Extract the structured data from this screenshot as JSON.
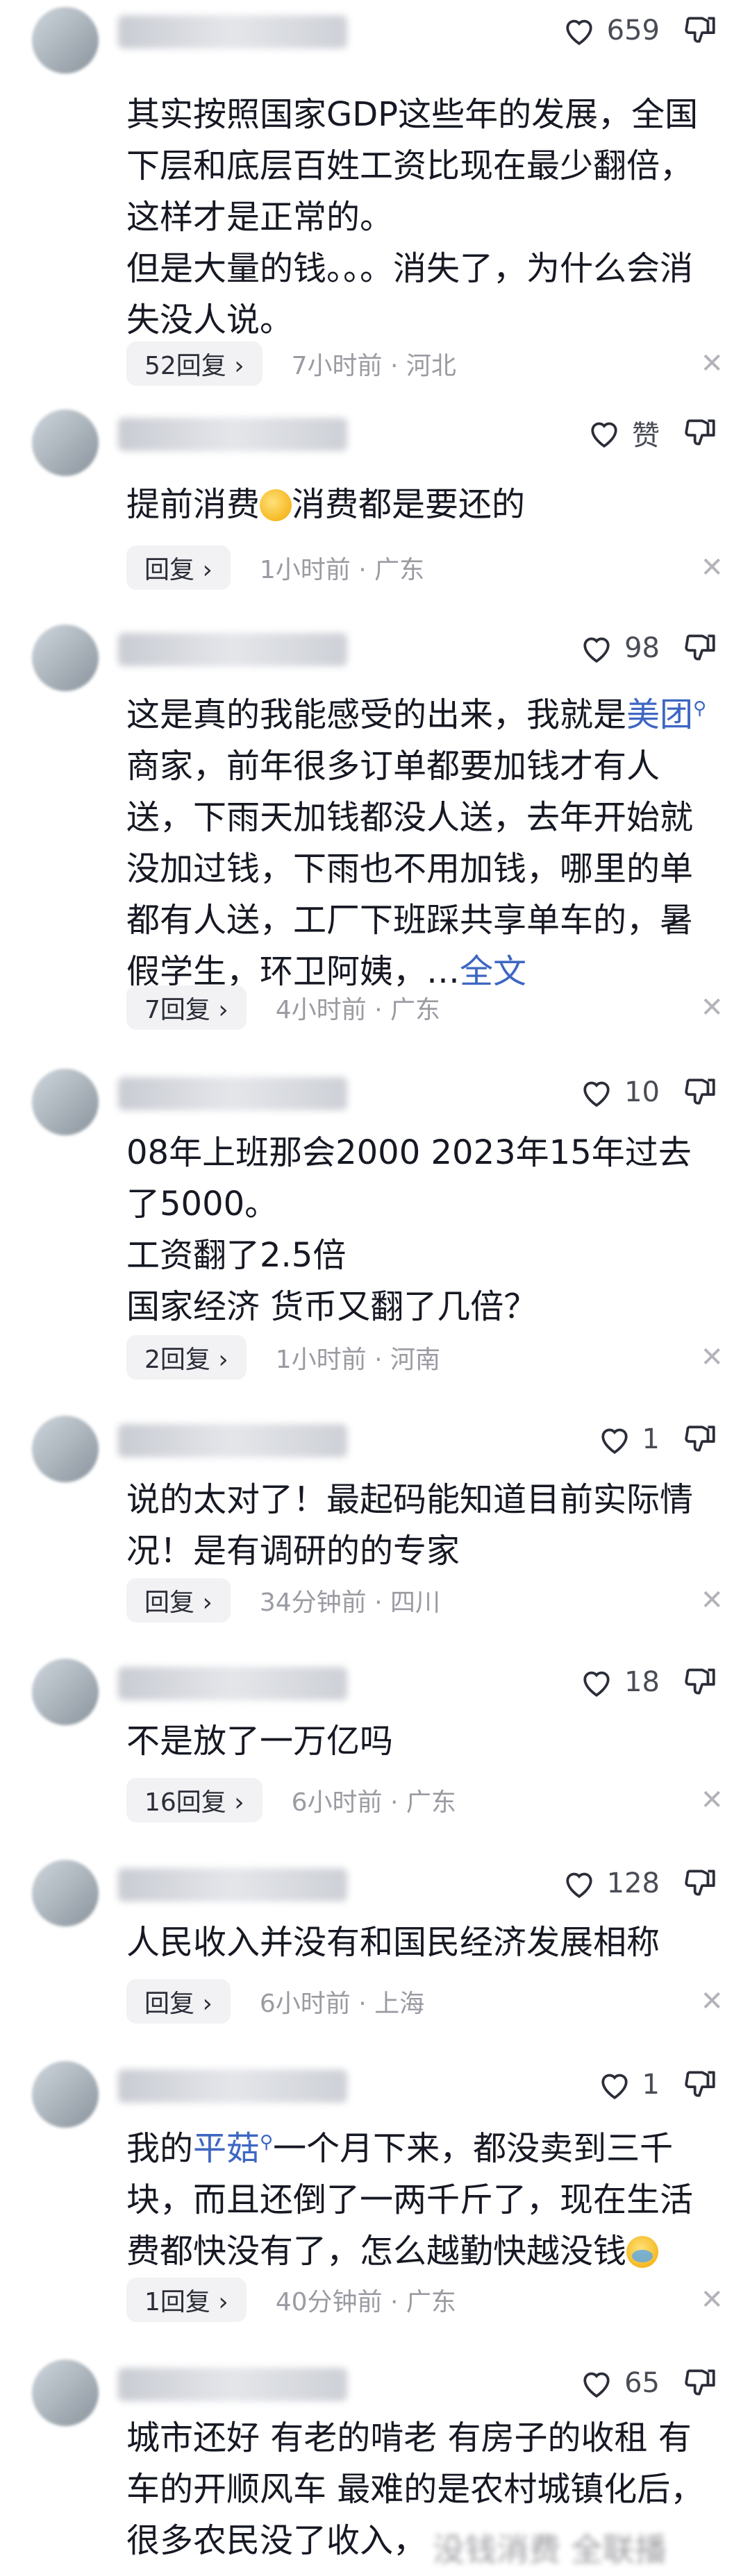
{
  "comments": [
    {
      "likes": "659",
      "text": "其实按照国家GDP这些年的发展，全国下层和底层百姓工资比现在最少翻倍，这样才是正常的。\n但是大量的钱。。。消失了，为什么会消失没人说。",
      "reply_label": "52回复 ›",
      "meta": "7小时前 · 河北"
    },
    {
      "likes": "赞",
      "text_pre": "提前消费",
      "text_post": "消费都是要还的",
      "reply_label": "回复 ›",
      "meta": "1小时前 · 广东"
    },
    {
      "likes": "98",
      "text_pre": "这是真的我能感受的出来，我就是",
      "link": "美团",
      "text_post": "商家，前年很多订单都要加钱才有人送，下雨天加钱都没人送，去年开始就没加过钱，下雨也不用加钱，哪里的单都有人送，工厂下班踩共享单车的，暑假学生，环卫阿姨，…",
      "more_label": "全文",
      "reply_label": "7回复 ›",
      "meta": "4小时前 · 广东"
    },
    {
      "likes": "10",
      "text": "08年上班那会2000 2023年15年过去了5000。\n工资翻了2.5倍\n国家经济 货币又翻了几倍？",
      "reply_label": "2回复 ›",
      "meta": "1小时前 · 河南"
    },
    {
      "likes": "1",
      "text": "说的太对了！最起码能知道目前实际情况！是有调研的的专家",
      "reply_label": "回复 ›",
      "meta": "34分钟前 · 四川"
    },
    {
      "likes": "18",
      "text": "不是放了一万亿吗",
      "reply_label": "16回复 ›",
      "meta": "6小时前 · 广东"
    },
    {
      "likes": "128",
      "text": "人民收入并没有和国民经济发展相称",
      "reply_label": "回复 ›",
      "meta": "6小时前 · 上海"
    },
    {
      "likes": "1",
      "text_pre": "我的",
      "link": "平菇",
      "text_post": "一个月下来，都没卖到三千块，而且还倒了一两千斤了，现在生活费都快没有了，怎么越勤快越没钱",
      "reply_label": "1回复 ›",
      "meta": "40分钟前 · 广东"
    },
    {
      "likes": "65",
      "text": "城市还好 有老的啃老 有房子的收租 有车的开顺风车 最难的是农村城镇化后，很多农民没了收入，",
      "watermark": "没钱消费 全联播"
    }
  ],
  "icons": {
    "like": "heart-outline-icon",
    "dislike": "thumbs-down-icon",
    "close": "close-icon",
    "search": "search-mini-icon"
  },
  "colors": {
    "link": "#3e67c3",
    "meta": "#9a9ba2",
    "reply_bg": "#f2f2f4"
  }
}
